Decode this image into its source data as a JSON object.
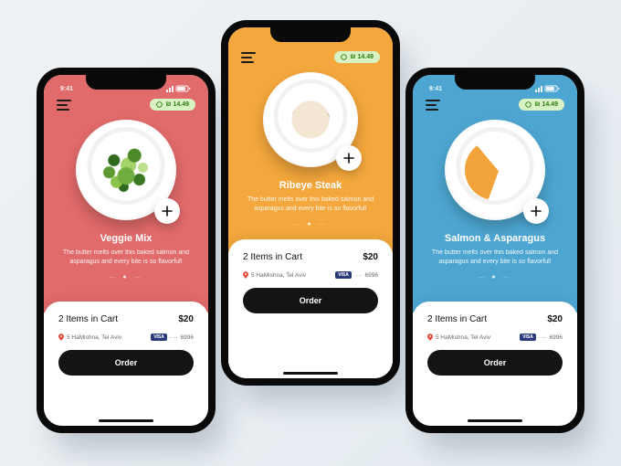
{
  "status": {
    "time": "9:41"
  },
  "price_badge": {
    "label": "₪ 14.49"
  },
  "screens": [
    {
      "side": "left",
      "accent": "#e16a6a",
      "dish": {
        "title": "Veggie Mix",
        "description": "The butter melts over this baked salmon and asparagus and every bite is so flavorful!",
        "plate_kind": "veggie"
      },
      "cart": {
        "summary": "2 Items in Cart",
        "total": "$20",
        "address": "5 HaMishna, Tel Aviv",
        "card_brand": "VISA",
        "card_last4": "6996",
        "order_label": "Order"
      }
    },
    {
      "side": "center",
      "accent": "#f3a73c",
      "dish": {
        "title": "Ribeye Steak",
        "description": "The butter melts over this baked salmon and asparagus and every bite is so flavorful!",
        "plate_kind": "steak"
      },
      "cart": {
        "summary": "2 Items in Cart",
        "total": "$20",
        "address": "5 HaMishna, Tel Aviv",
        "card_brand": "VISA",
        "card_last4": "6996",
        "order_label": "Order"
      }
    },
    {
      "side": "right",
      "accent": "#4da6d1",
      "dish": {
        "title": "Salmon & Asparagus",
        "description": "The butter melts over this baked salmon and asparagus and every bite is so flavorful!",
        "plate_kind": "salmon"
      },
      "cart": {
        "summary": "2 Items in Cart",
        "total": "$20",
        "address": "5 HaMishna, Tel Aviv",
        "card_brand": "VISA",
        "card_last4": "6996",
        "order_label": "Order"
      }
    }
  ]
}
